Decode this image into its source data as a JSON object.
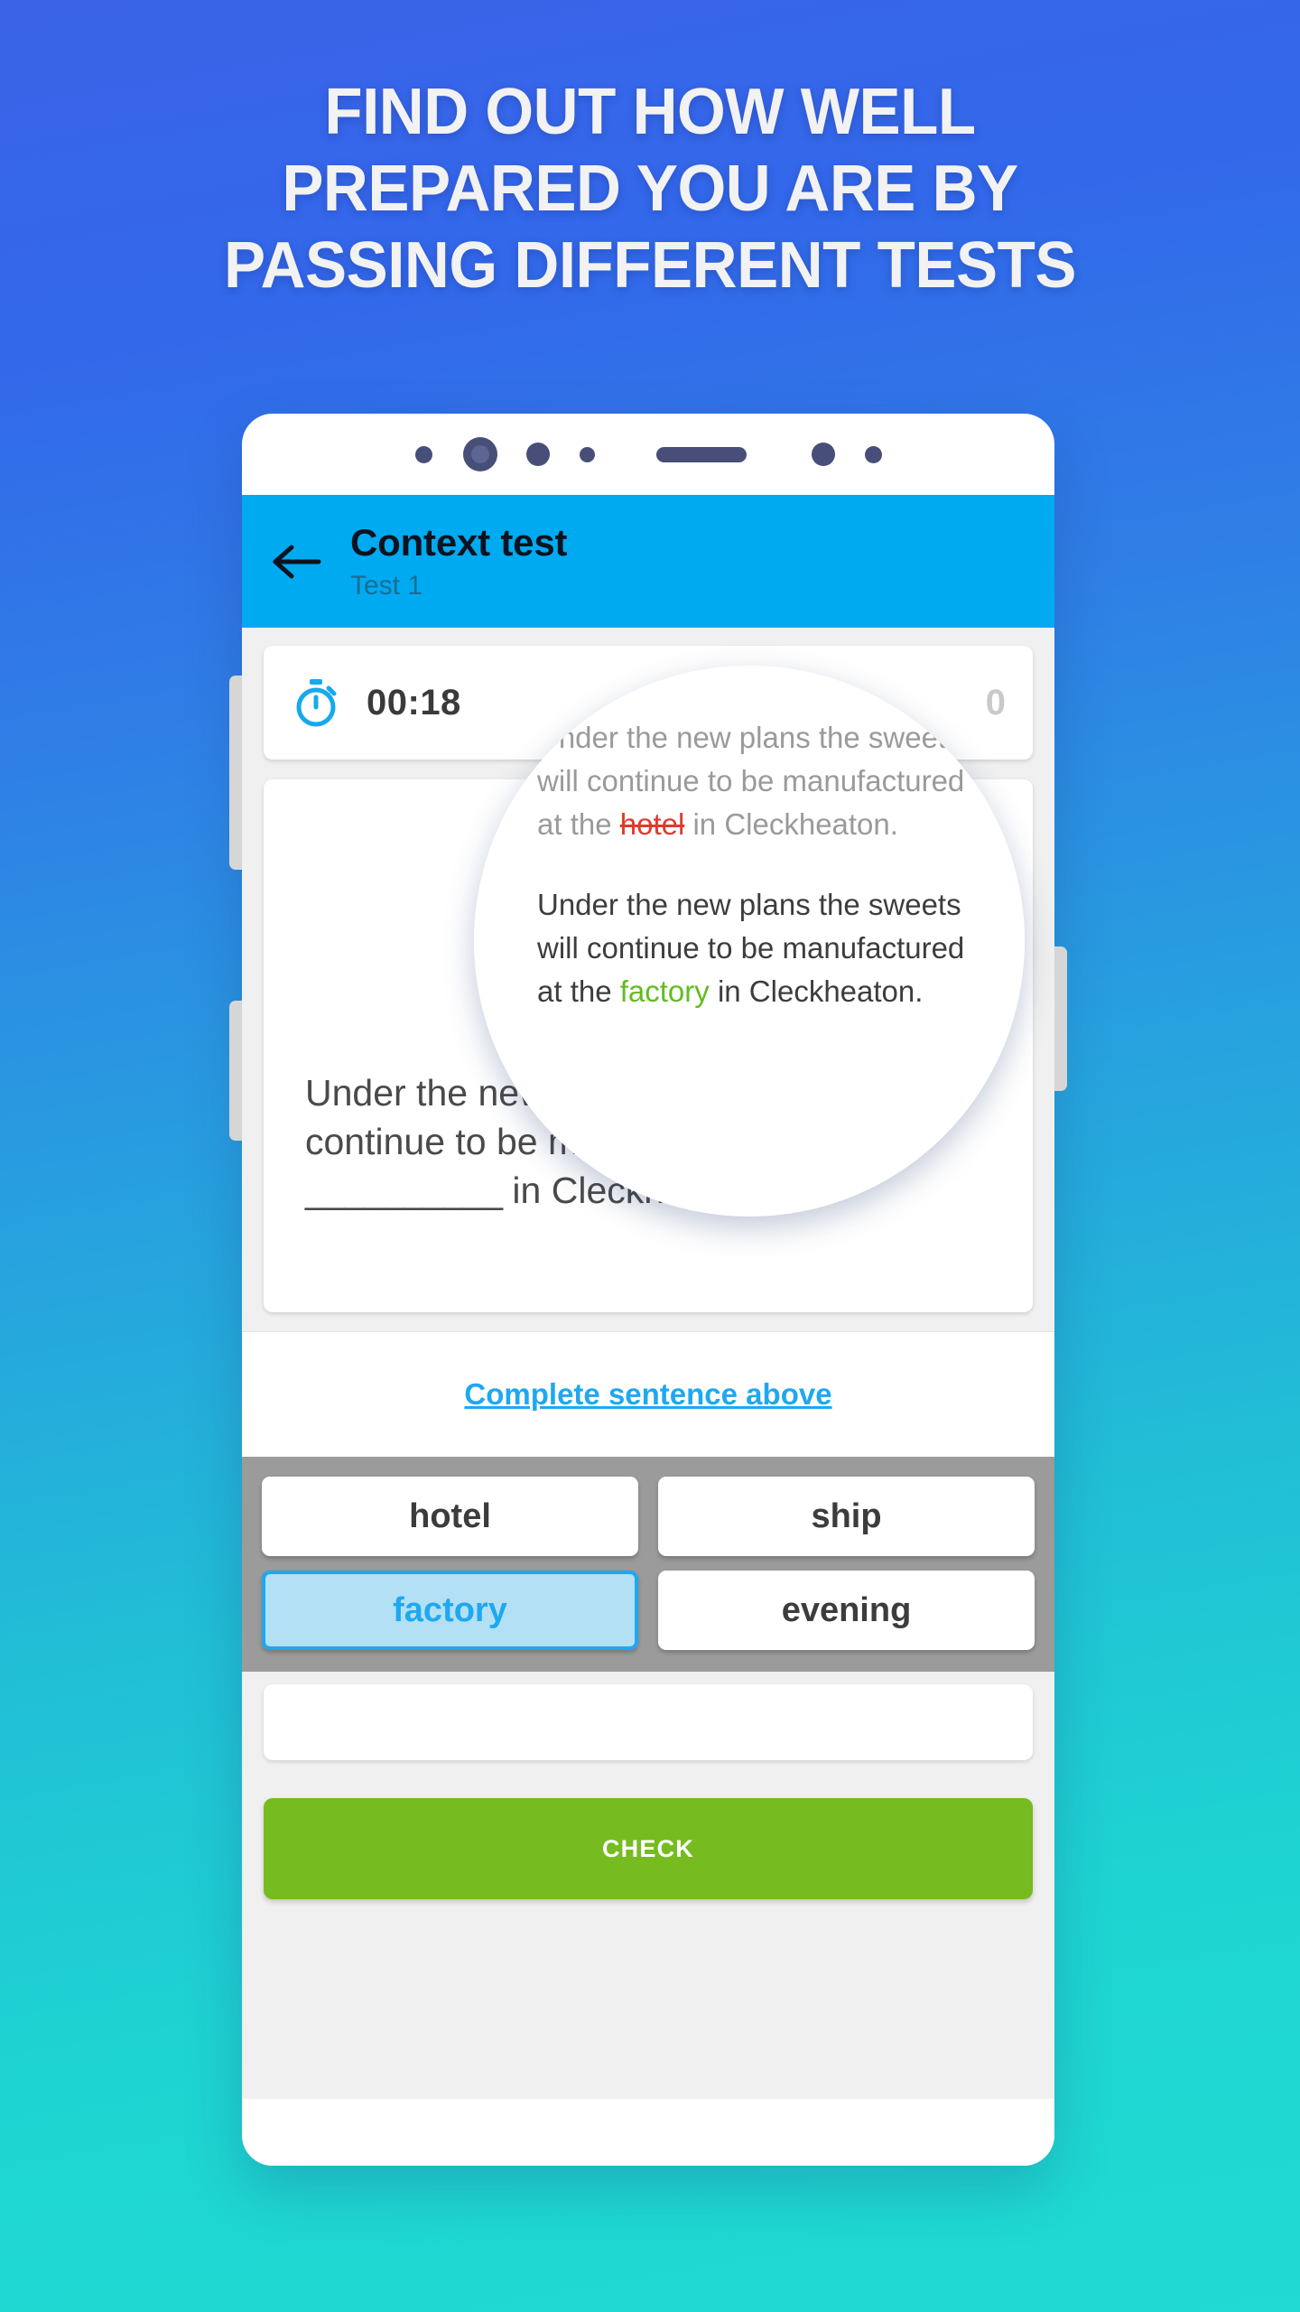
{
  "headline": {
    "lines": [
      "FIND OUT HOW WELL",
      "PREPARED YOU ARE BY",
      "PASSING DIFFERENT TESTS"
    ]
  },
  "colors": {
    "bg_top": "#3b63e8",
    "bg_bottom": "#20dbd2",
    "appbar": "#00aaf0",
    "accent_blue": "#1fa8f0",
    "check_green": "#76bc20",
    "chip_tray": "#9b9b9b",
    "wrong_red": "#e03a2f",
    "correct_green": "#61bd1f"
  },
  "appbar": {
    "back_icon": "arrow-left-icon",
    "title": "Context test",
    "subtitle": "Test 1"
  },
  "timer": {
    "icon": "stopwatch-icon",
    "value": "00:18",
    "right_value": "0"
  },
  "question": {
    "text_before": "Under the new plans the sweets will continue to be manufactured at the ",
    "blank": "__________",
    "text_after": " in Cleckheaton."
  },
  "complete_link": "Complete sentence above",
  "answers": {
    "options": [
      {
        "label": "hotel",
        "selected": false
      },
      {
        "label": "ship",
        "selected": false
      },
      {
        "label": "factory",
        "selected": true
      },
      {
        "label": "evening",
        "selected": false
      }
    ]
  },
  "check_button": "CHECK",
  "magnifier": {
    "wrong": {
      "before": "Under the new plans the sweets will continue to be manufactured at the ",
      "word": "hotel",
      "after": " in Cleckheaton."
    },
    "right": {
      "before": "Under the new plans the sweets will continue to be manufactured at the ",
      "word": "factory",
      "after": " in Cleckheaton."
    }
  }
}
